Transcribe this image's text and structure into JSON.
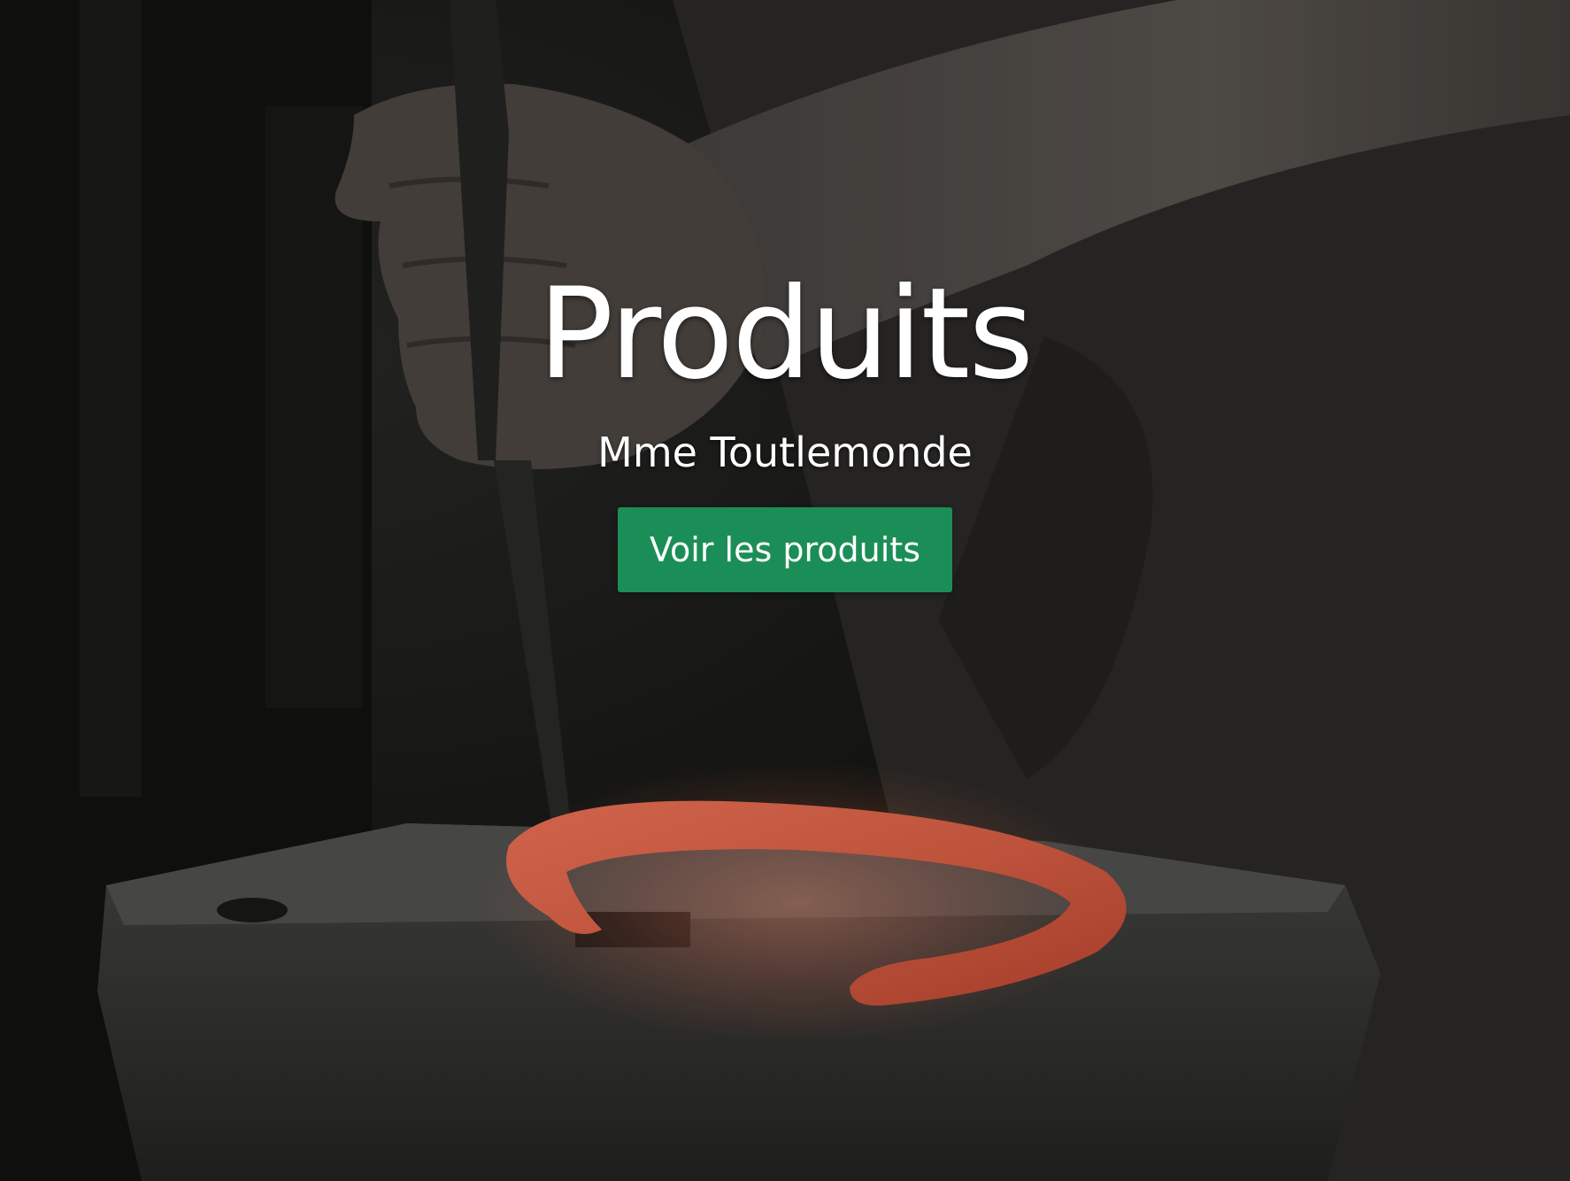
{
  "hero": {
    "title": "Produits",
    "subtitle": "Mme Toutlemonde",
    "cta_label": "Voir les produits",
    "background_image": "blacksmith-forging-horseshoe-on-anvil"
  },
  "colors": {
    "cta_background": "#1b8e57",
    "text": "#ffffff",
    "horseshoe": "#e8664a"
  }
}
